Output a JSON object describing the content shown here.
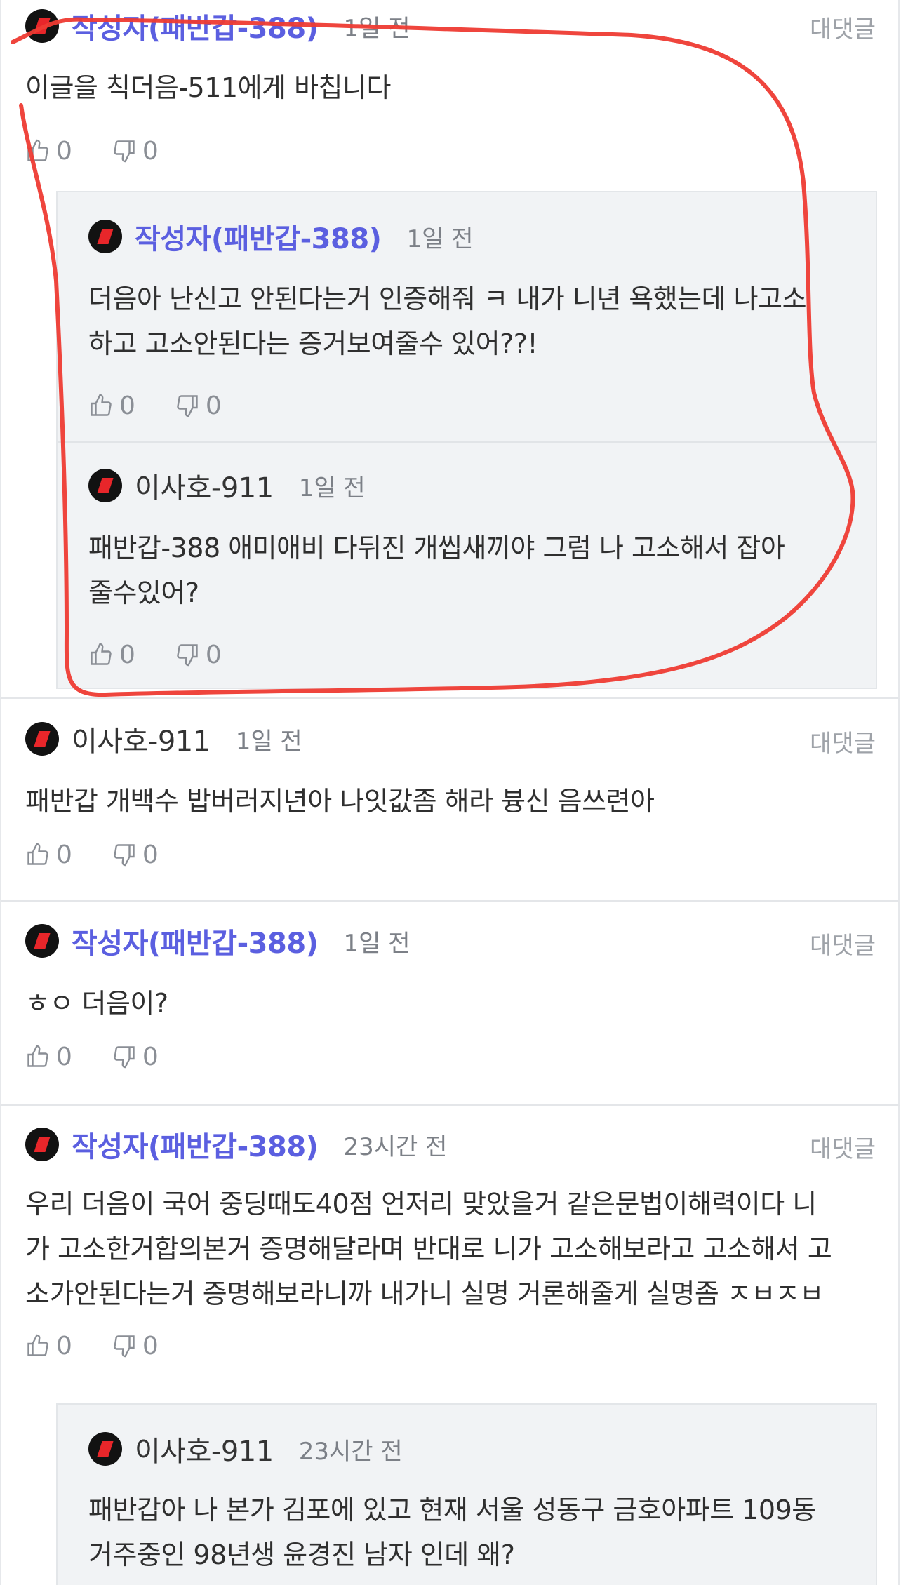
{
  "comments": [
    {
      "author": "작성자(패반갑-388)",
      "time": "1일 전",
      "reply_label": "대댓글",
      "body_lines": [
        "이글을 칙더음-511에게 바칩니다"
      ],
      "likes": "0",
      "dislikes": "0",
      "replies": [
        {
          "author": "작성자(패반갑-388)",
          "time": "1일 전",
          "body_lines": [
            "더음아 난신고 안된다는거 인증해줘 ㅋ 내가 니년 욕했는데 나고소",
            "하고 고소안된다는 증거보여줄수 있어??!"
          ],
          "likes": "0",
          "dislikes": "0"
        },
        {
          "author": "이사호-911",
          "time": "1일 전",
          "body_lines": [
            "패반갑-388 애미애비 다뒤진 개씹새끼야 그럼 나 고소해서 잡아",
            "줄수있어?"
          ],
          "likes": "0",
          "dislikes": "0"
        }
      ]
    },
    {
      "author": "이사호-911",
      "time": "1일 전",
      "reply_label": "대댓글",
      "body_lines": [
        "패반갑 개백수 밥버러지년아 나잇값좀 해라 븅신 음쓰련아"
      ],
      "likes": "0",
      "dislikes": "0"
    },
    {
      "author": "작성자(패반갑-388)",
      "time": "1일 전",
      "reply_label": "대댓글",
      "body_lines": [
        "ㅎㅇ 더음이?"
      ],
      "likes": "0",
      "dislikes": "0"
    },
    {
      "author": "작성자(패반갑-388)",
      "time": "23시간 전",
      "reply_label": "대댓글",
      "body_lines": [
        "우리 더음이 국어 중딩때도40점 언저리 맞았을거 같은문법이해력이다 니",
        "가 고소한거합의본거 증명해달라며 반대로 니가 고소해보라고 고소해서 고",
        "소가안된다는거 증명해보라니까 내가니 실명 거론해줄게 실명좀 ㅈㅂㅈㅂ"
      ],
      "likes": "0",
      "dislikes": "0",
      "replies": [
        {
          "author": "이사호-911",
          "time": "23시간 전",
          "body_lines": [
            "패반갑아 나 본가 김포에 있고 현재 서울 성동구 금호아파트 109동",
            "거주중인 98년생 윤경진 남자 인데 왜?"
          ]
        }
      ]
    }
  ],
  "colors": {
    "author_name": "#5b5fe0",
    "annotation_stroke": "#ee3b33",
    "nested_bg": "#f1f3f5",
    "avatar_mark": "#e8262a"
  },
  "icons": {
    "like": "thumbs-up-icon",
    "dislike": "thumbs-down-icon"
  }
}
